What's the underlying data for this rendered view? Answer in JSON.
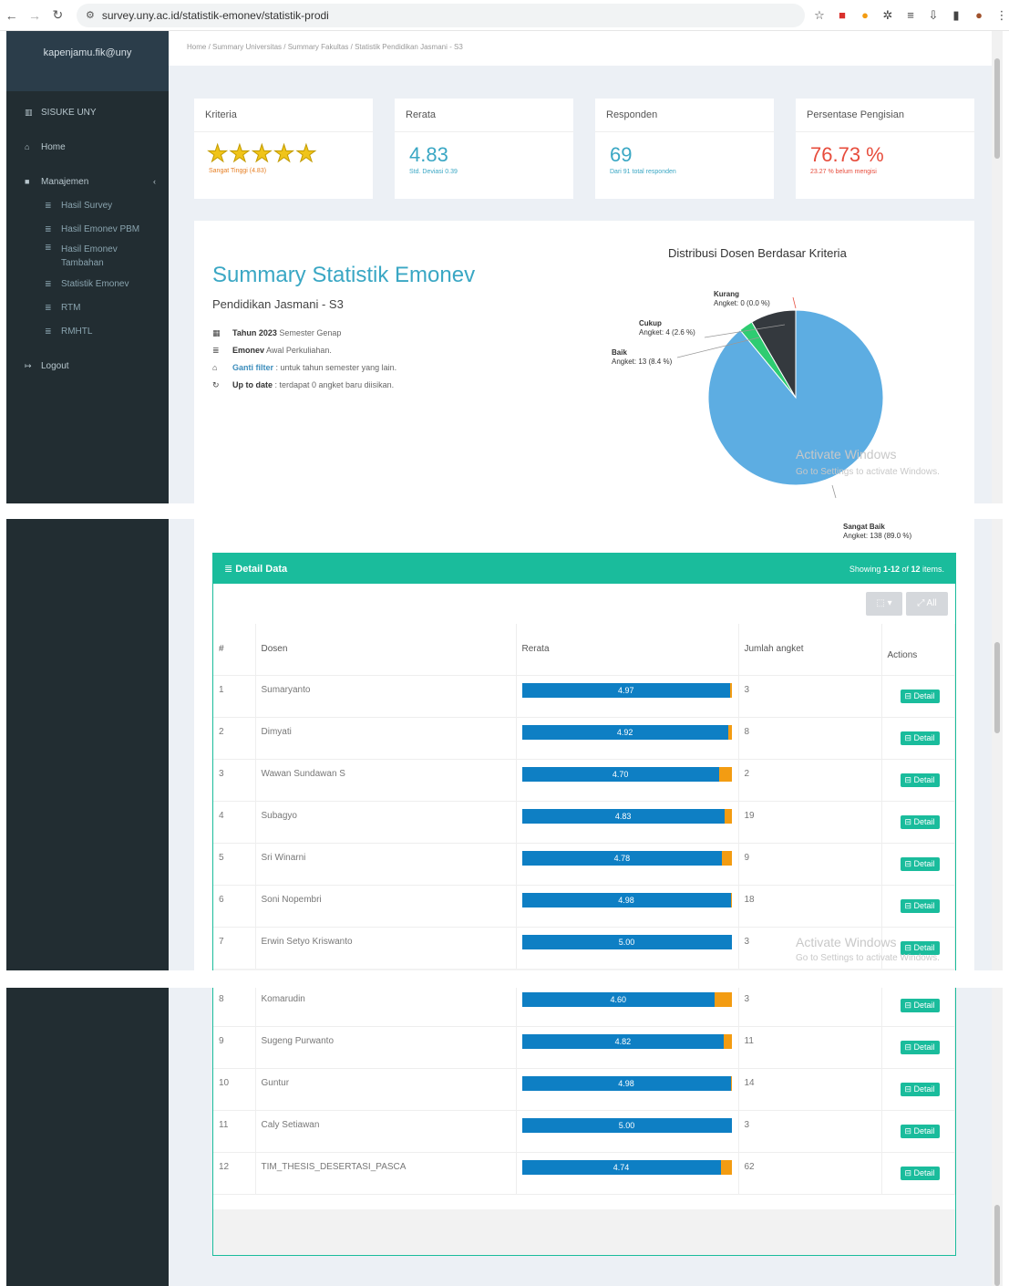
{
  "browser": {
    "url": "survey.uny.ac.id/statistik-emonev/statistik-prodi"
  },
  "sidebar": {
    "user": "kapenjamu.fik@uny",
    "items": [
      {
        "label": "SISUKE UNY"
      },
      {
        "label": "Home"
      },
      {
        "label": "Manajemen"
      }
    ],
    "subitems": [
      {
        "label": "Hasil Survey"
      },
      {
        "label": "Hasil Emonev PBM"
      },
      {
        "label": "Hasil Emonev Tambahan"
      },
      {
        "label": "Statistik Emonev"
      },
      {
        "label": "RTM"
      },
      {
        "label": "RMHTL"
      }
    ],
    "logout": "Logout"
  },
  "breadcrumb": [
    "Home",
    "Summary Universitas",
    "Summary Fakultas",
    "Statistik Pendidikan Jasmani - S3"
  ],
  "kpis": [
    {
      "header": "Kriteria",
      "value": "",
      "sub": "Sangat Tinggi (4.83)"
    },
    {
      "header": "Rerata",
      "value": "4.83",
      "sub": "Std. Deviasi 0.39"
    },
    {
      "header": "Responden",
      "value": "69",
      "sub": "Dari 91 total responden"
    },
    {
      "header": "Persentase Pengisian",
      "value": "76.73 %",
      "sub": "23.27 % belum mengisi"
    }
  ],
  "summary": {
    "title": "Summary Statistik Emonev",
    "subtitle": "Pendidikan Jasmani - S3",
    "year_bold": "Tahun 2023",
    "year_rest": " Semester Genap",
    "emonev_bold": "Emonev",
    "emonev_rest": " Awal Perkuliahan.",
    "filter_bold": "Ganti filter",
    "filter_rest": " : untuk tahun semester yang lain.",
    "uptodate_bold": "Up to date",
    "uptodate_rest": " : terdapat 0 angket baru diisikan."
  },
  "chart_data": {
    "type": "pie",
    "title": "Distribusi Dosen Berdasar Kriteria",
    "slices": [
      {
        "name": "Sangat Baik",
        "value": 138,
        "pct": 89.0,
        "color": "#5dade2"
      },
      {
        "name": "Baik",
        "value": 13,
        "pct": 8.4,
        "color": "#34393e"
      },
      {
        "name": "Cukup",
        "value": 4,
        "pct": 2.6,
        "color": "#2ecc71"
      },
      {
        "name": "Kurang",
        "value": 0,
        "pct": 0.0,
        "color": "#e74c3c"
      }
    ],
    "labels": [
      {
        "name": "Kurang",
        "detail": "Angket: 0 (0.0 %)"
      },
      {
        "name": "Cukup",
        "detail": "Angket: 4 (2.6 %)"
      },
      {
        "name": "Baik",
        "detail": "Angket: 13 (8.4 %)"
      },
      {
        "name": "Sangat Baik",
        "detail": "Angket: 138 (89.0 %)"
      }
    ]
  },
  "watermark": {
    "title": "Activate Windows",
    "sub": "Go to Settings to activate Windows."
  },
  "detail": {
    "title": "Detail Data",
    "showing_prefix": "Showing ",
    "showing_range": "1-12",
    "showing_mid": " of ",
    "showing_total": "12",
    "showing_suffix": " items.",
    "all_label": "All",
    "columns": [
      "#",
      "Dosen",
      "Rerata",
      "Jumlah angket",
      "Actions"
    ],
    "detail_label": "Detail",
    "rows": [
      {
        "no": "1",
        "dosen": "Sumaryanto",
        "rerata": "4.97",
        "score": 4.97,
        "jumlah": "3"
      },
      {
        "no": "2",
        "dosen": "Dimyati",
        "rerata": "4.92",
        "score": 4.92,
        "jumlah": "8"
      },
      {
        "no": "3",
        "dosen": "Wawan Sundawan S",
        "rerata": "4.70",
        "score": 4.7,
        "jumlah": "2"
      },
      {
        "no": "4",
        "dosen": "Subagyo",
        "rerata": "4.83",
        "score": 4.83,
        "jumlah": "19"
      },
      {
        "no": "5",
        "dosen": "Sri Winarni",
        "rerata": "4.78",
        "score": 4.78,
        "jumlah": "9"
      },
      {
        "no": "6",
        "dosen": "Soni Nopembri",
        "rerata": "4.98",
        "score": 4.98,
        "jumlah": "18"
      },
      {
        "no": "7",
        "dosen": "Erwin Setyo Kriswanto",
        "rerata": "5.00",
        "score": 5.0,
        "jumlah": "3"
      },
      {
        "no": "8",
        "dosen": "Komarudin",
        "rerata": "4.60",
        "score": 4.6,
        "jumlah": "3"
      },
      {
        "no": "9",
        "dosen": "Sugeng Purwanto",
        "rerata": "4.82",
        "score": 4.82,
        "jumlah": "11"
      },
      {
        "no": "10",
        "dosen": "Guntur",
        "rerata": "4.98",
        "score": 4.98,
        "jumlah": "14"
      },
      {
        "no": "11",
        "dosen": "Caly Setiawan",
        "rerata": "5.00",
        "score": 5.0,
        "jumlah": "3"
      },
      {
        "no": "12",
        "dosen": "TIM_THESIS_DESERTASI_PASCA",
        "rerata": "4.74",
        "score": 4.74,
        "jumlah": "62"
      }
    ]
  }
}
